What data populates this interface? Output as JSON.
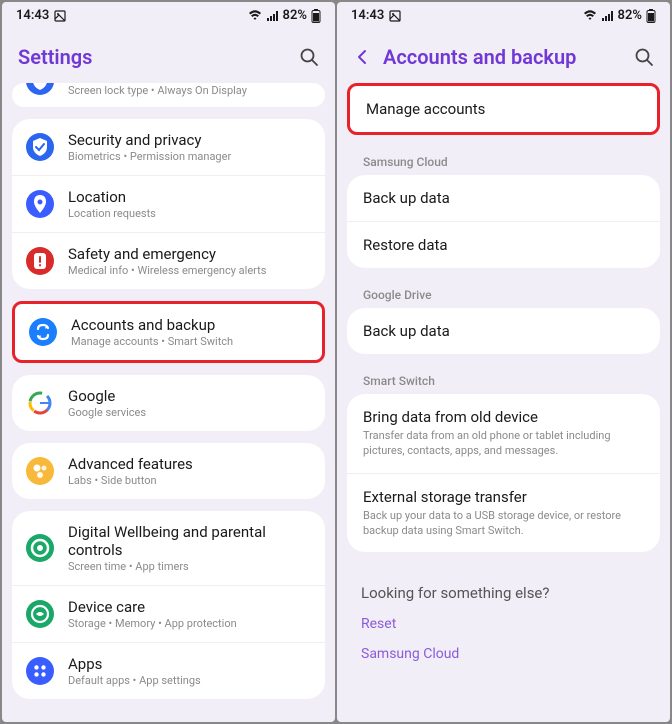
{
  "status": {
    "time": "14:43",
    "battery": "82%"
  },
  "left": {
    "title": "Settings",
    "groups": [
      {
        "cropped": true,
        "items": [
          {
            "iconColor": "#2b65f0",
            "shape": "shield",
            "title": "",
            "subtitle": "Screen lock type  •  Always On Display"
          }
        ]
      },
      {
        "items": [
          {
            "iconColor": "#2b65f0",
            "shape": "shield-check",
            "title": "Security and privacy",
            "subtitle": "Biometrics  •  Permission manager"
          },
          {
            "iconColor": "#3a5dff",
            "shape": "pin",
            "title": "Location",
            "subtitle": "Location requests"
          },
          {
            "iconColor": "#d92b2b",
            "shape": "alert",
            "title": "Safety and emergency",
            "subtitle": "Medical info  •  Wireless emergency alerts"
          }
        ]
      },
      {
        "highlighted": true,
        "items": [
          {
            "iconColor": "#1a7eff",
            "shape": "sync",
            "title": "Accounts and backup",
            "subtitle": "Manage accounts  •  Smart Switch"
          }
        ]
      },
      {
        "items": [
          {
            "iconColor": "#fff",
            "shape": "google",
            "title": "Google",
            "subtitle": "Google services"
          }
        ]
      },
      {
        "items": [
          {
            "iconColor": "#f8b93a",
            "shape": "features",
            "title": "Advanced features",
            "subtitle": "Labs  •  Side button"
          }
        ]
      },
      {
        "items": [
          {
            "iconColor": "#1aa868",
            "shape": "wellbeing",
            "title": "Digital Wellbeing and parental controls",
            "subtitle": "Screen time  •  App timers"
          },
          {
            "iconColor": "#1aa868",
            "shape": "device",
            "title": "Device care",
            "subtitle": "Storage  •  Memory  •  App protection"
          },
          {
            "iconColor": "#3a5dff",
            "shape": "apps",
            "title": "Apps",
            "subtitle": "Default apps  •  App settings"
          }
        ]
      }
    ]
  },
  "right": {
    "title": "Accounts and backup",
    "groups": [
      {
        "highlighted": true,
        "items": [
          {
            "title": "Manage accounts"
          }
        ]
      },
      {
        "label": "Samsung Cloud",
        "items": [
          {
            "title": "Back up data"
          },
          {
            "title": "Restore data"
          }
        ]
      },
      {
        "label": "Google Drive",
        "items": [
          {
            "title": "Back up data"
          }
        ]
      },
      {
        "label": "Smart Switch",
        "items": [
          {
            "title": "Bring data from old device",
            "sub": "Transfer data from an old phone or tablet including pictures, contacts, apps, and messages."
          },
          {
            "title": "External storage transfer",
            "sub": "Back up your data to a USB storage device, or restore backup data using Smart Switch."
          }
        ]
      }
    ],
    "footer": {
      "heading": "Looking for something else?",
      "links": [
        "Reset",
        "Samsung Cloud"
      ]
    }
  }
}
